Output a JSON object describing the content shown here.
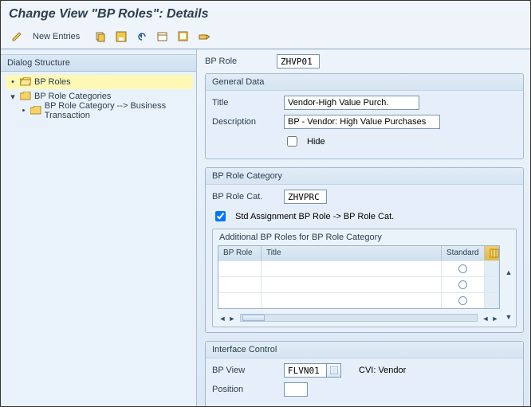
{
  "title": "Change View \"BP Roles\": Details",
  "toolbar": {
    "new_entries": "New Entries"
  },
  "dialog_structure": {
    "header": "Dialog Structure",
    "items": [
      {
        "label": "BP Roles"
      },
      {
        "label": "BP Role Categories"
      },
      {
        "label": "BP Role Category --> Business Transaction"
      }
    ]
  },
  "bp_role": {
    "label": "BP Role",
    "value": "ZHVP01"
  },
  "general_data": {
    "legend": "General Data",
    "title_label": "Title",
    "title_value": "Vendor-High Value Purch.",
    "desc_label": "Description",
    "desc_value": "BP - Vendor: High Value Purchases",
    "hide_label": "Hide"
  },
  "bp_role_cat": {
    "legend": "BP Role Category",
    "cat_label": "BP Role Cat.",
    "cat_value": "ZHVPRC",
    "std_label": "Std Assignment BP Role -> BP Role Cat.",
    "additional": {
      "legend": "Additional BP Roles for BP Role Category",
      "cols": {
        "role": "BP Role",
        "title": "Title",
        "std": "Standard"
      }
    }
  },
  "interface_control": {
    "legend": "Interface Control",
    "view_label": "BP View",
    "view_value": "FLVN01",
    "view_text": "CVI: Vendor",
    "pos_label": "Position"
  }
}
